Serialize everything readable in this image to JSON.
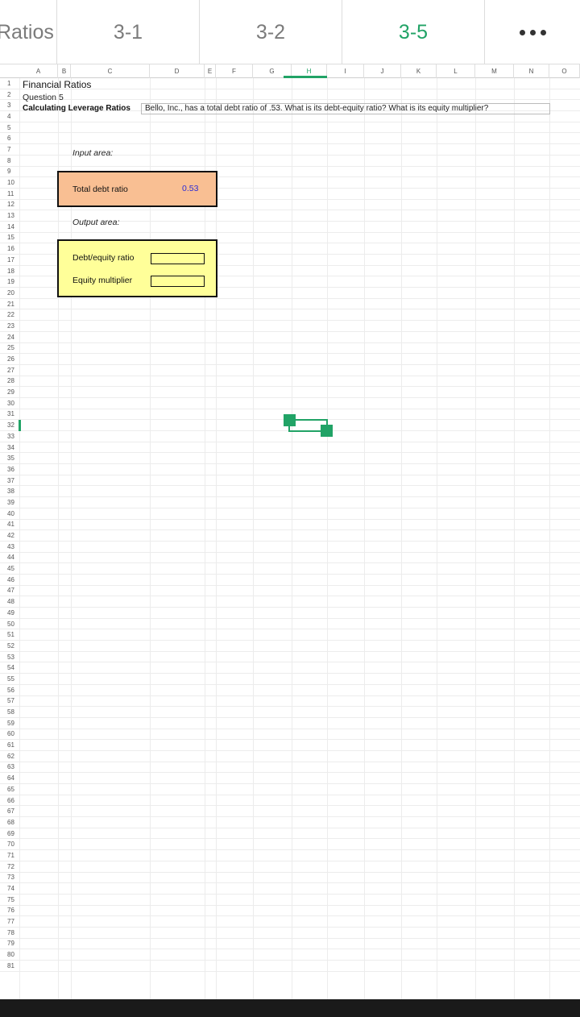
{
  "tabs": [
    {
      "label": "Ratios",
      "active": false
    },
    {
      "label": "3-1",
      "active": false
    },
    {
      "label": "3-2",
      "active": false
    },
    {
      "label": "3-5",
      "active": true
    }
  ],
  "more_icon": "more-horizontal-icon",
  "columns": [
    "A",
    "B",
    "C",
    "D",
    "E",
    "F",
    "G",
    "H",
    "I",
    "J",
    "K",
    "L",
    "M",
    "N",
    "O"
  ],
  "selected_column": "H",
  "selected_row": 31,
  "row_count": 81,
  "sheet": {
    "title": "Financial Ratios",
    "question": "Question 5",
    "topic": "Calculating Leverage Ratios",
    "prompt": "Bello, Inc., has a total debt ratio of .53. What is its debt-equity ratio? What is its equity multiplier?",
    "input_label": "Input area:",
    "output_label": "Output area:",
    "total_debt_ratio_label": "Total debt ratio",
    "total_debt_ratio_value": "0.53",
    "debt_equity_label": "Debt/equity ratio",
    "equity_multiplier_label": "Equity multiplier",
    "debt_equity_value": "",
    "equity_multiplier_value": ""
  },
  "colors": {
    "accent": "#21a366",
    "input_fill": "#f9bf93",
    "output_fill": "#ffff99",
    "value_text": "#2b2bd6"
  }
}
